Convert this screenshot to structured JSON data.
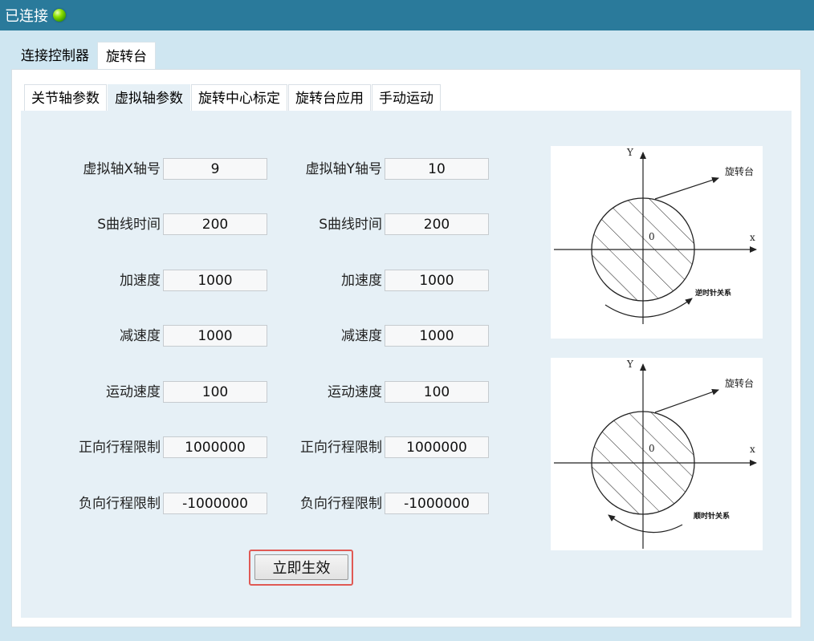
{
  "titlebar": {
    "status": "已连接"
  },
  "main_tabs": [
    {
      "label": "连接控制器"
    },
    {
      "label": "旋转台"
    }
  ],
  "sub_tabs": [
    {
      "label": "关节轴参数"
    },
    {
      "label": "虚拟轴参数"
    },
    {
      "label": "旋转中心标定"
    },
    {
      "label": "旋转台应用"
    },
    {
      "label": "手动运动"
    }
  ],
  "left_params": [
    {
      "label": "虚拟轴X轴号",
      "value": "9"
    },
    {
      "label": "S曲线时间",
      "value": "200"
    },
    {
      "label": "加速度",
      "value": "1000"
    },
    {
      "label": "减速度",
      "value": "1000"
    },
    {
      "label": "运动速度",
      "value": "100"
    },
    {
      "label": "正向行程限制",
      "value": "1000000"
    },
    {
      "label": "负向行程限制",
      "value": "-1000000"
    }
  ],
  "right_params": [
    {
      "label": "虚拟轴Y轴号",
      "value": "10"
    },
    {
      "label": "S曲线时间",
      "value": "200"
    },
    {
      "label": "加速度",
      "value": "1000"
    },
    {
      "label": "减速度",
      "value": "1000"
    },
    {
      "label": "运动速度",
      "value": "100"
    },
    {
      "label": "正向行程限制",
      "value": "1000000"
    },
    {
      "label": "负向行程限制",
      "value": "-1000000"
    }
  ],
  "apply_button": {
    "label": "立即生效"
  },
  "diagram_top": {
    "y_label": "Y",
    "x_label": "x",
    "origin_label": "0",
    "table_label": "旋转台",
    "direction_label": "逆时针关系"
  },
  "diagram_bottom": {
    "y_label": "Y",
    "x_label": "x",
    "origin_label": "0",
    "table_label": "旋转台",
    "direction_label": "顺时针关系"
  },
  "colors": {
    "titlebar": "#2a7a9b",
    "status_led": "#6fd400",
    "highlight": "#e05a55"
  }
}
